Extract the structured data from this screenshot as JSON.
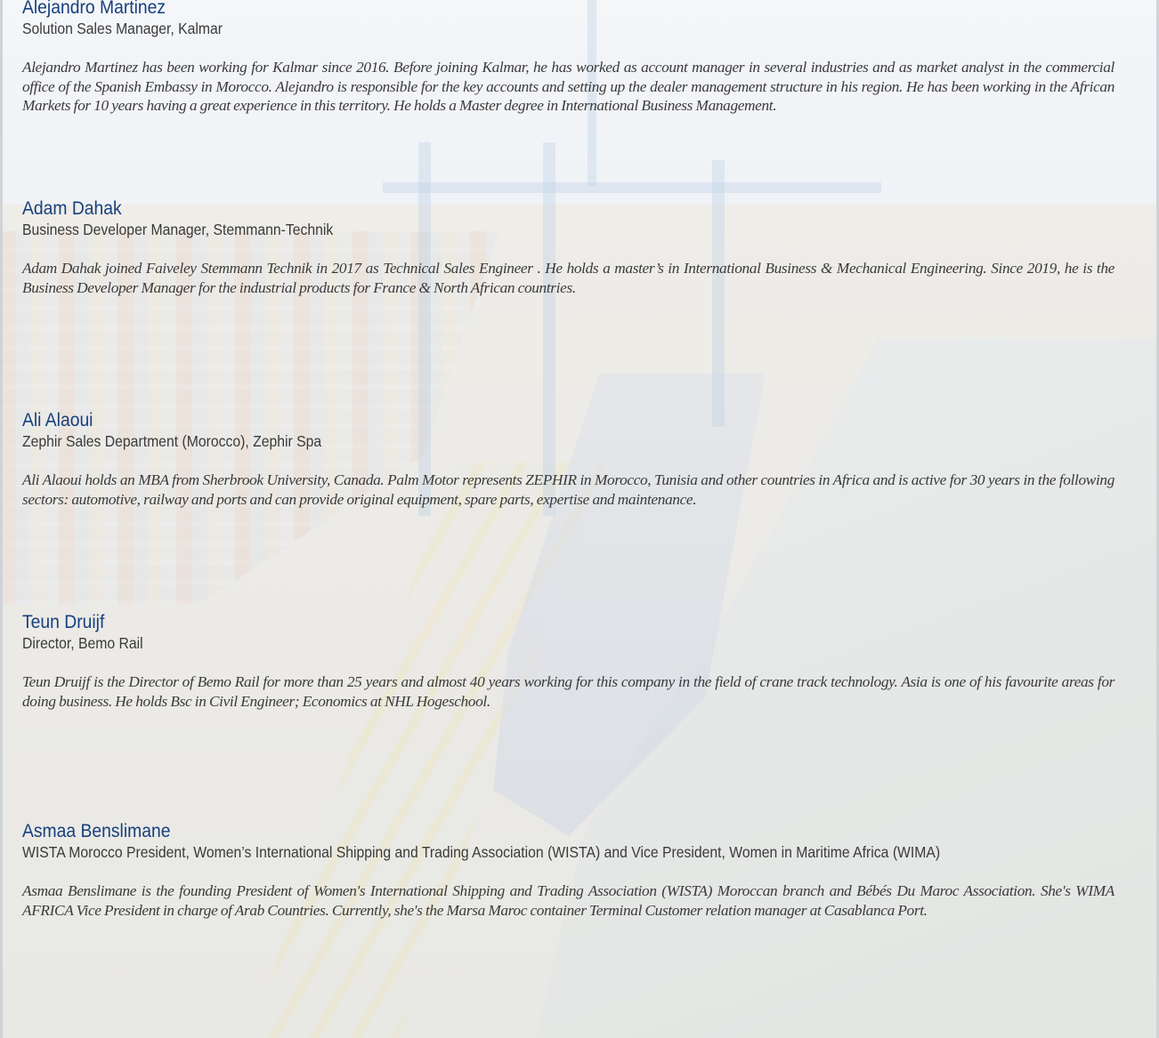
{
  "speakers": [
    {
      "name": "Alejandro Martinez",
      "role": "Solution Sales Manager, Kalmar",
      "bio": "Alejandro Martinez has been working for Kalmar since 2016. Before joining Kalmar, he has worked as account manager in several industries and as market analyst in the commercial office of the Spanish Embassy in Morocco. Alejandro is responsible for the key accounts and setting up the dealer management structure in his region. He has been working in the African Markets for 10 years having a great experience in this territory. He holds a Master degree in International Business Management."
    },
    {
      "name": "Adam Dahak",
      "role": "Business Developer Manager, Stemmann-Technik",
      "bio": "Adam Dahak joined Faiveley Stemmann Technik in 2017 as Technical Sales Engineer . He holds a master’s in International Business & Mechanical Engineering. Since 2019, he is the Business Developer Manager for the industrial products for France & North African countries."
    },
    {
      "name": "Ali Alaoui",
      "role": "Zephir Sales Department (Morocco), Zephir Spa",
      "bio": "Ali Alaoui holds an MBA from Sherbrook University, Canada. Palm Motor represents ZEPHIR in Morocco, Tunisia and other countries in Africa and is active for 30 years in the following sectors: automotive, railway and ports and can provide original equipment, spare parts, expertise and maintenance."
    },
    {
      "name": "Teun Druijf",
      "role": "Director, Bemo Rail",
      "bio": "Teun Druijf is the Director of Bemo Rail for more than 25 years and almost 40 years working for this company in the field of crane track technology. Asia is one of his favourite areas for doing business. He holds Bsc in Civil Engineer; Economics at NHL Hogeschool."
    },
    {
      "name": "Asmaa Benslimane",
      "role": "WISTA Morocco President, Women’s International Shipping and Trading Association (WISTA) and Vice President, Women in Maritime Africa (WIMA)",
      "bio": "Asmaa Benslimane is the founding President of Women's International Shipping and Trading Association (WISTA) Moroccan branch and Bébés Du Maroc Association. She's WIMA AFRICA Vice President in charge of Arab Countries. Currently, she's the Marsa Maroc container Terminal Customer relation manager at Casablanca Port."
    }
  ]
}
